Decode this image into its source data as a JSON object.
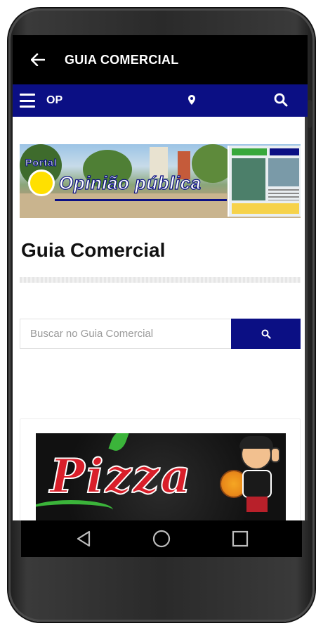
{
  "app_bar": {
    "title": "GUIA COMERCIAL",
    "back_icon": "arrow-left-icon"
  },
  "nav_bar": {
    "brand": "OP",
    "menu_icon": "hamburger-menu-icon",
    "location_icon": "map-pin-icon",
    "search_icon": "search-icon",
    "color": "#0b0f84"
  },
  "banner": {
    "portal_text": "Portal",
    "logo_text": "Opinião pública"
  },
  "page": {
    "title": "Guia Comercial"
  },
  "search": {
    "placeholder": "Buscar no Guia Comercial",
    "value": "",
    "button_icon": "search-icon"
  },
  "ad": {
    "text": "Pizza"
  },
  "system_nav": {
    "back": "triangle-back-icon",
    "home": "circle-home-icon",
    "recents": "square-recents-icon"
  },
  "colors": {
    "app_bar_bg": "#000000",
    "accent_blue": "#0b0f84",
    "title_text": "#111111"
  }
}
